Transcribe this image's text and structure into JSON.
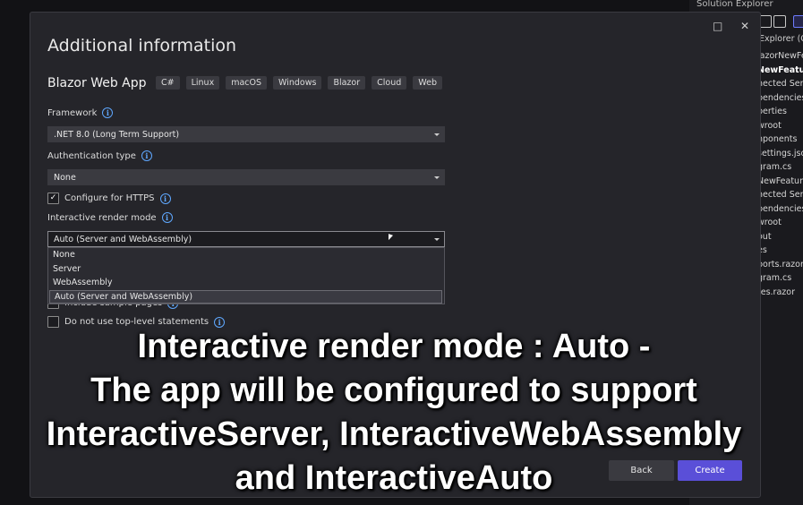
{
  "solution_explorer": {
    "title": "Solution Explorer",
    "tab": "Explorer (C",
    "items": [
      {
        "label": "lazorNewFe",
        "bold": false
      },
      {
        "label": "NewFeature",
        "bold": true
      },
      {
        "label": "nected Serv",
        "bold": false
      },
      {
        "label": "pendencies",
        "bold": false
      },
      {
        "label": "perties",
        "bold": false
      },
      {
        "label": "wroot",
        "bold": false
      },
      {
        "label": "nponents",
        "bold": false
      },
      {
        "label": "settings.jso",
        "bold": false
      },
      {
        "label": "gram.cs",
        "bold": false
      },
      {
        "label": "NewFeature",
        "bold": false
      },
      {
        "label": "nected Serv",
        "bold": false
      },
      {
        "label": "pendencies",
        "bold": false
      },
      {
        "label": "wroot",
        "bold": false
      },
      {
        "label": "out",
        "bold": false
      },
      {
        "label": "es",
        "bold": false
      },
      {
        "label": "ports.razor",
        "bold": false
      },
      {
        "label": "gram.cs",
        "bold": false
      },
      {
        "label": "tes.razor",
        "bold": false
      }
    ]
  },
  "dialog": {
    "title": "Additional information",
    "maximize_icon": "□",
    "close_icon": "✕",
    "project_name": "Blazor Web App",
    "tags": [
      "C#",
      "Linux",
      "macOS",
      "Windows",
      "Blazor",
      "Cloud",
      "Web"
    ],
    "framework_label": "Framework",
    "framework_value": ".NET 8.0 (Long Term Support)",
    "auth_label": "Authentication type",
    "auth_value": "None",
    "https_label": "Configure for HTTPS",
    "https_checked": true,
    "render_label": "Interactive render mode",
    "render_value": "Auto (Server and WebAssembly)",
    "render_options": [
      "None",
      "Server",
      "WebAssembly",
      "Auto (Server and WebAssembly)"
    ],
    "render_selected_index": 3,
    "sample_pages_label": "Include sample pages",
    "top_level_label": "Do not use top-level statements",
    "top_level_checked": false,
    "back_label": "Back",
    "create_label": "Create",
    "info_icon": "i"
  },
  "caption": {
    "lines": [
      "Interactive render mode : Auto -",
      "The app will be configured to support",
      "InteractiveServer, InteractiveWebAssembly",
      "and InteractiveAuto"
    ]
  },
  "colors": {
    "accent": "#5a4fd8",
    "info": "#5fa8ff",
    "background": "#25252a"
  }
}
